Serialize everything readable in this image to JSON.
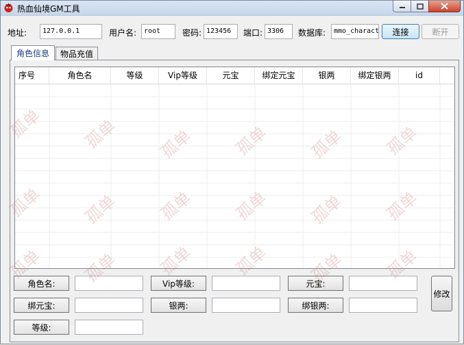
{
  "window": {
    "title": "热血仙境GM工具"
  },
  "connection": {
    "address_label": "地址:",
    "address_value": "127.0.0.1",
    "user_label": "用户名:",
    "user_value": "root",
    "password_label": "密码:",
    "password_value": "123456",
    "port_label": "端口:",
    "port_value": "3306",
    "database_label": "数据库:",
    "database_value": "mmo_charact",
    "connect_label": "连接",
    "disconnect_label": "断开"
  },
  "tabs": [
    {
      "label": "角色信息",
      "active": true
    },
    {
      "label": "物品充值",
      "active": false
    }
  ],
  "table": {
    "columns": [
      "序号",
      "角色名",
      "等级",
      "Vip等级",
      "元宝",
      "绑定元宝",
      "银两",
      "绑定银两",
      "id"
    ],
    "rows": []
  },
  "form": {
    "role_name_label": "角色名:",
    "vip_level_label": "Vip等级:",
    "yuanbao_label": "元宝:",
    "bind_yuanbao_label": "绑元宝:",
    "silver_label": "银两:",
    "bind_silver_label": "绑银两:",
    "level_label": "等级:",
    "modify_label": "修改"
  },
  "watermark_text": "孤单"
}
